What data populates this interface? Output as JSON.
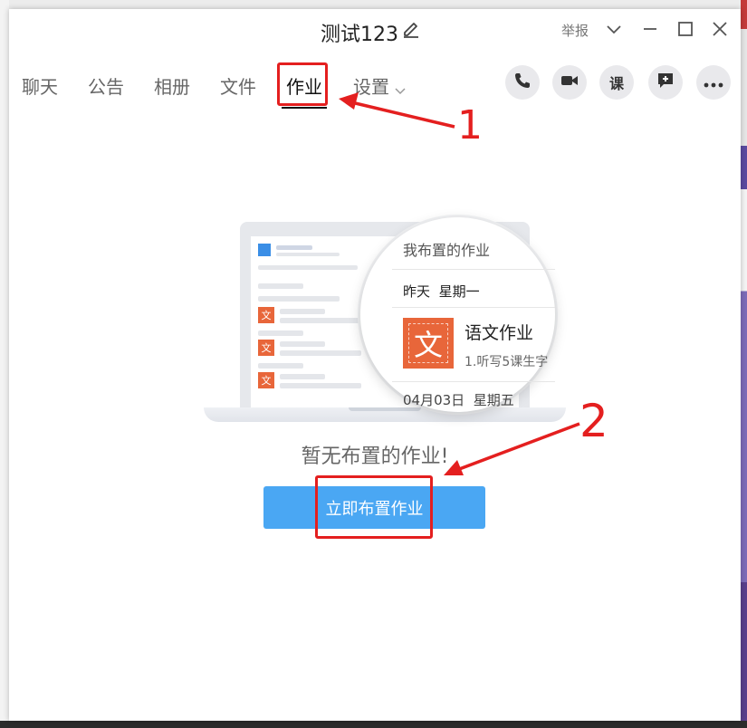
{
  "window": {
    "title": "测试123",
    "report_label": "举报"
  },
  "tabs": [
    {
      "label": "聊天",
      "active": false
    },
    {
      "label": "公告",
      "active": false
    },
    {
      "label": "相册",
      "active": false
    },
    {
      "label": "文件",
      "active": false
    },
    {
      "label": "作业",
      "active": true
    },
    {
      "label": "设置",
      "active": false
    }
  ],
  "toolbar": {
    "course_label": "课",
    "icons": [
      "phone-icon",
      "video-icon",
      "course-icon",
      "add-comment-icon",
      "more-icon"
    ]
  },
  "illustration": {
    "panel_title": "我布置的作业",
    "date_label": "昨天",
    "weekday_label": "星期一",
    "subject_char": "文",
    "subject_title": "语文作业",
    "subject_desc": "1.听写5课生字",
    "second_date": "04月03日",
    "second_weekday": "星期五"
  },
  "main": {
    "empty_message": "暂无布置的作业!",
    "assign_button": "立即布置作业"
  },
  "annotations": {
    "label_1": "1",
    "label_2": "2",
    "color": "#e41f1f"
  },
  "colors": {
    "accent_button": "#4aa7f3",
    "homework_icon": "#e8663a"
  }
}
